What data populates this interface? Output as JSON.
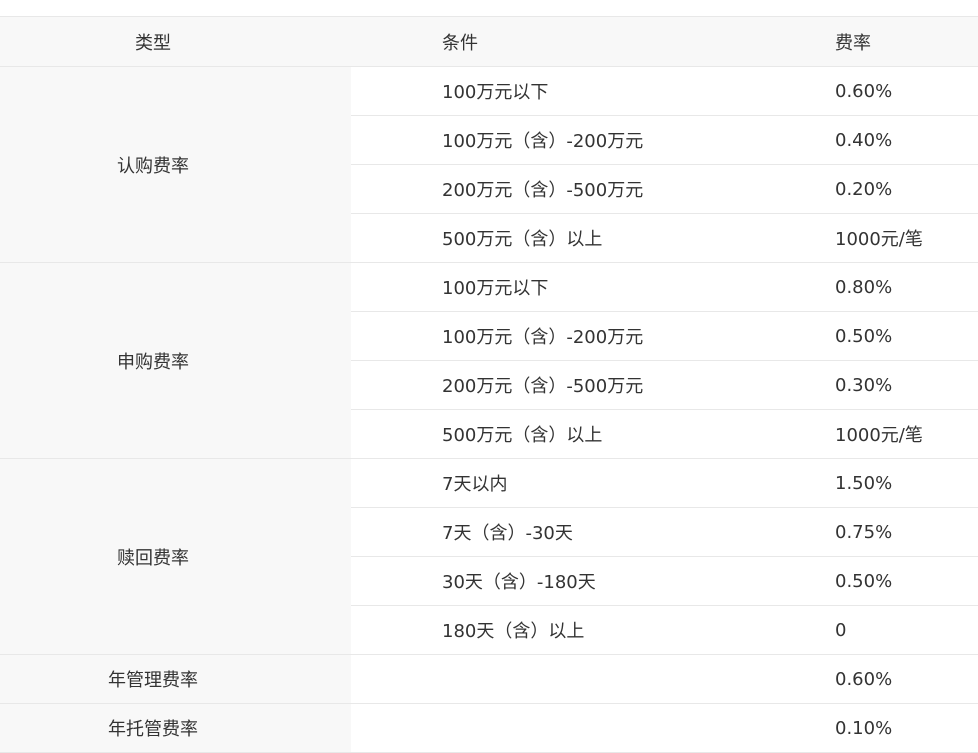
{
  "headers": {
    "type": "类型",
    "condition": "条件",
    "rate": "费率"
  },
  "groups": [
    {
      "type": "认购费率",
      "rows": [
        {
          "condition": "100万元以下",
          "rate": "0.60%"
        },
        {
          "condition": "100万元（含）-200万元",
          "rate": "0.40%"
        },
        {
          "condition": "200万元（含）-500万元",
          "rate": "0.20%"
        },
        {
          "condition": "500万元（含）以上",
          "rate": "1000元/笔"
        }
      ]
    },
    {
      "type": "申购费率",
      "rows": [
        {
          "condition": "100万元以下",
          "rate": "0.80%"
        },
        {
          "condition": "100万元（含）-200万元",
          "rate": "0.50%"
        },
        {
          "condition": "200万元（含）-500万元",
          "rate": "0.30%"
        },
        {
          "condition": "500万元（含）以上",
          "rate": "1000元/笔"
        }
      ]
    },
    {
      "type": "赎回费率",
      "rows": [
        {
          "condition": "7天以内",
          "rate": "1.50%"
        },
        {
          "condition": "7天（含）-30天",
          "rate": "0.75%"
        },
        {
          "condition": "30天（含）-180天",
          "rate": "0.50%"
        },
        {
          "condition": "180天（含）以上",
          "rate": "0"
        }
      ]
    },
    {
      "type": "年管理费率",
      "rows": [
        {
          "condition": "",
          "rate": "0.60%"
        }
      ]
    },
    {
      "type": "年托管费率",
      "rows": [
        {
          "condition": "",
          "rate": "0.10%"
        }
      ]
    }
  ]
}
